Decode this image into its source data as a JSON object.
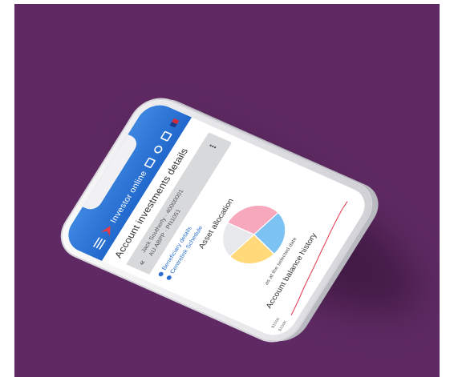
{
  "app": {
    "title": "Investor online"
  },
  "page": {
    "title": "Account investments details"
  },
  "account": {
    "line1": "Jack Southerly · 40000001",
    "line2": "AU ABPP · PN1051"
  },
  "links": [
    {
      "label": "Beneficiary details"
    },
    {
      "label": "Centrelink Schedule"
    }
  ],
  "asset_allocation": {
    "title": "Asset allocation",
    "caption": "as at the selected date",
    "colors": [
      "#f7a8bd",
      "#7cc2f2",
      "#ffd97a",
      "#e7e8ec"
    ],
    "shares": [
      0.3,
      0.25,
      0.25,
      0.2
    ]
  },
  "balance_history": {
    "title": "Account balance history",
    "y_ticks": [
      "$150K",
      "$100K"
    ],
    "line_color": "#e0435a",
    "points": [
      0.05,
      0.12,
      0.2,
      0.3,
      0.38,
      0.45,
      0.52,
      0.6,
      0.68,
      0.75,
      0.83,
      0.9,
      0.96,
      1.0,
      0.98
    ]
  },
  "icons": {
    "menu": "menu-icon",
    "card": "card-icon",
    "gear": "gear-icon",
    "exit": "exit-icon",
    "flag": "flag-icon",
    "logo": "logo-icon",
    "collapse": "collapse-icon",
    "more": "more-icon"
  },
  "colors": {
    "background": "#5f2a63",
    "appbar": "#2168cd",
    "card": "#d8d9db",
    "link": "#2a6fcf"
  }
}
